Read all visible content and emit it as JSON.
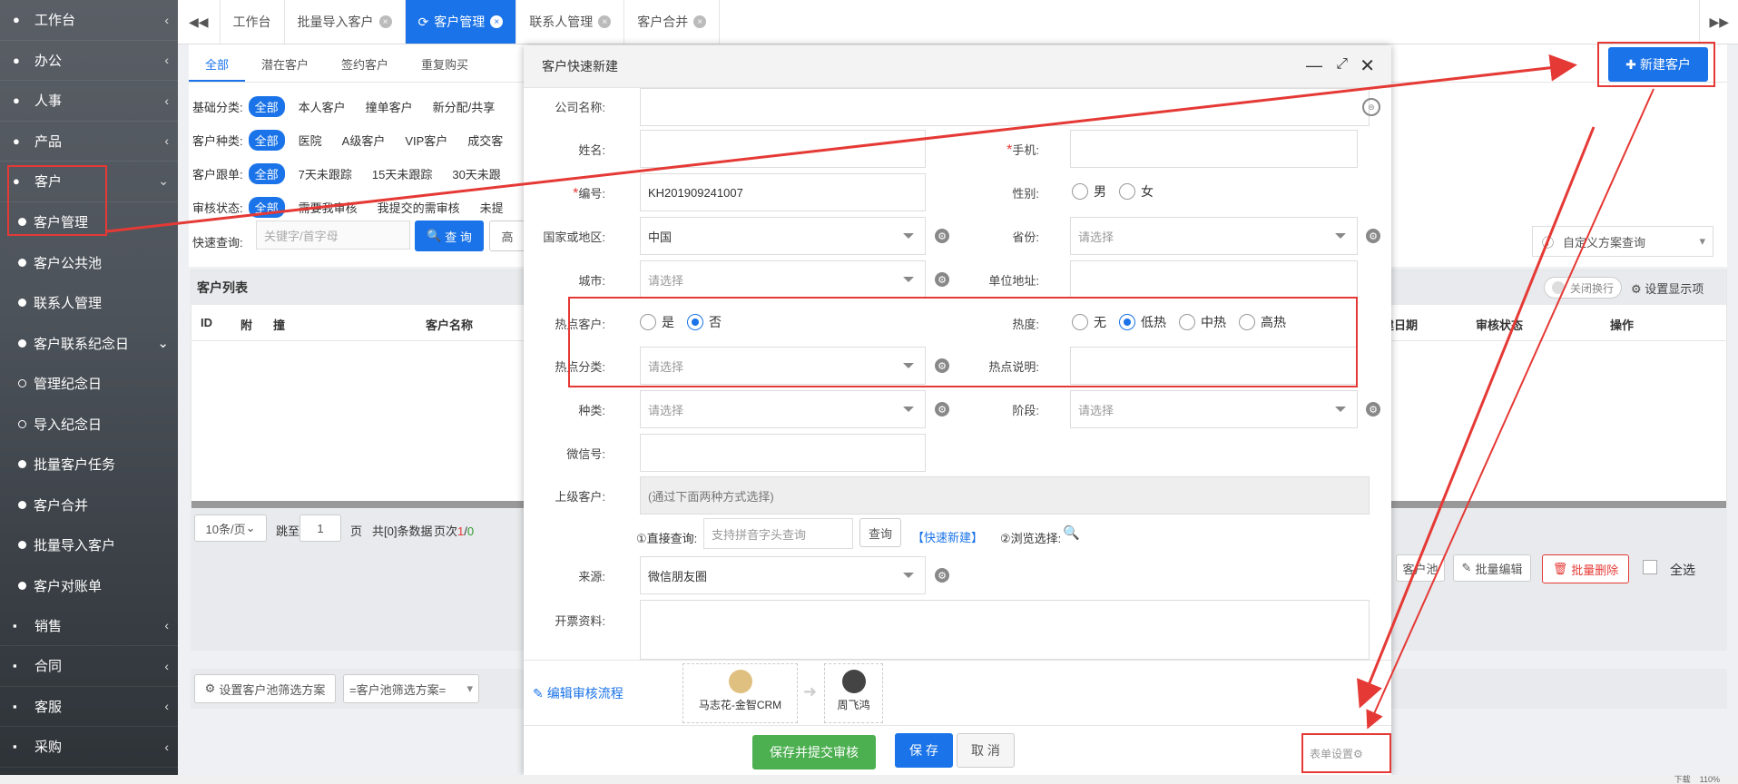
{
  "sidebar": {
    "items": [
      {
        "icon": "heart-icon",
        "label": "工作台"
      },
      {
        "icon": "laptop-icon",
        "label": "办公"
      },
      {
        "icon": "users-icon",
        "label": "人事"
      },
      {
        "icon": "product-icon",
        "label": "产品"
      },
      {
        "icon": "diamond-icon",
        "label": "客户"
      }
    ],
    "sub_items": [
      {
        "label": "客户管理"
      },
      {
        "label": "客户公共池"
      },
      {
        "label": "联系人管理"
      },
      {
        "label": "客户联系纪念日"
      },
      {
        "label": "管理纪念日"
      },
      {
        "label": "导入纪念日"
      },
      {
        "label": "批量客户任务"
      },
      {
        "label": "客户合并"
      },
      {
        "label": "批量导入客户"
      },
      {
        "label": "客户对账单"
      }
    ],
    "bottom_items": [
      {
        "icon": "chart-icon",
        "label": "销售"
      },
      {
        "icon": "contract-icon",
        "label": "合同"
      },
      {
        "icon": "phone-icon",
        "label": "客服"
      },
      {
        "icon": "cart-icon",
        "label": "采购"
      }
    ]
  },
  "tabs": [
    "工作台",
    "批量导入客户",
    "客户管理",
    "联系人管理",
    "客户合并"
  ],
  "filters": {
    "top_tabs": [
      "全部",
      "潜在客户",
      "签约客户",
      "重复购买"
    ],
    "rows": [
      {
        "label": "基础分类:",
        "options": [
          "全部",
          "本人客户",
          "撞单客户",
          "新分配/共享"
        ]
      },
      {
        "label": "客户种类:",
        "options": [
          "全部",
          "医院",
          "A级客户",
          "VIP客户",
          "成交客"
        ]
      },
      {
        "label": "客户跟单:",
        "options": [
          "全部",
          "7天未跟踪",
          "15天未跟踪",
          "30天未跟"
        ]
      },
      {
        "label": "审核状态:",
        "options": [
          "全部",
          "需要我审核",
          "我提交的需审核",
          "未提"
        ]
      }
    ],
    "quick_label": "快速查询:",
    "quick_placeholder": "关键字/首字母",
    "query_btn": "查 询",
    "adv_btn": "高",
    "custom_query": "自定义方案查询",
    "new_customer": "新建客户"
  },
  "list": {
    "title": "客户列表",
    "close_wrap": "关闭换行",
    "set_display": "设置显示项",
    "columns": [
      "ID",
      "附",
      "撞",
      "客户名称",
      "建日期",
      "审核状态",
      "操作"
    ],
    "pager": {
      "per_page": "10条/页",
      "jump": "跳至",
      "page_val": "1",
      "page_unit": "页",
      "total": "共[0]条数据",
      "page_prefix": "页次",
      "page_cur": "1",
      "page_sep": "/",
      "page_total": "0"
    },
    "actions": {
      "pool": "客户池",
      "batch_edit": "批量编辑",
      "batch_delete": "批量删除",
      "select_all": "全选"
    },
    "pool_scheme_btn": "设置客户池筛选方案",
    "pool_scheme_select": "=客户池筛选方案="
  },
  "modal": {
    "title": "客户快速新建",
    "company_label": "公司名称:",
    "name_label": "姓名:",
    "mobile_label": "手机:",
    "code_label": "编号:",
    "code_value": "KH201909241007",
    "gender_label": "性别:",
    "gender_options": [
      "男",
      "女"
    ],
    "country_label": "国家或地区:",
    "country_value": "中国",
    "province_label": "省份:",
    "city_label": "城市:",
    "address_label": "单位地址:",
    "hot_label": "热点客户:",
    "hot_options": [
      "是",
      "否"
    ],
    "heat_label": "热度:",
    "heat_options": [
      "无",
      "低热",
      "中热",
      "高热"
    ],
    "hot_cat_label": "热点分类:",
    "hot_desc_label": "热点说明:",
    "kind_label": "种类:",
    "stage_label": "阶段:",
    "wechat_label": "微信号:",
    "parent_label": "上级客户:",
    "parent_placeholder": "(通过下面两种方式选择)",
    "direct_query_label": "①直接查询:",
    "direct_query_placeholder": "支持拼音字头查询",
    "query_btn": "查询",
    "quick_new": "【快速新建】",
    "browse": "②浏览选择:",
    "source_label": "来源:",
    "source_value": "微信朋友圈",
    "invoice_label": "开票资料:",
    "select_placeholder": "请选择",
    "edit_flow": "编辑审核流程",
    "approver1": "马志花-金智CRM",
    "approver2": "周飞鸿",
    "save_submit": "保存并提交审核",
    "save": "保 存",
    "cancel": "取 消",
    "form_settings": "表单设置"
  },
  "status_bar": {
    "download": "下载",
    "zoom": "110%"
  },
  "colors": {
    "accent": "#1a73e8",
    "annotation": "#e53935",
    "save_green": "#4caf50"
  }
}
